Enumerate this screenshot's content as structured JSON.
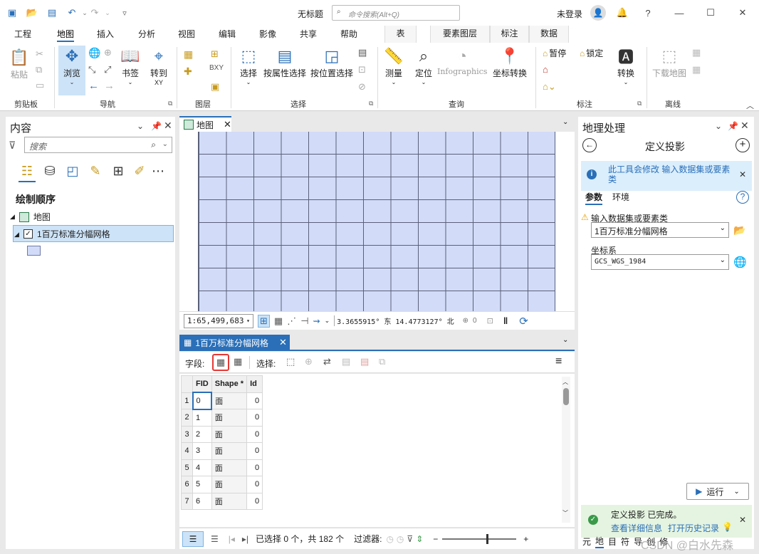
{
  "titlebar": {
    "title": "无标题",
    "search_placeholder": "命令搜索(Alt+Q)",
    "login": "未登录"
  },
  "tabs": [
    "工程",
    "地图",
    "插入",
    "分析",
    "视图",
    "编辑",
    "影像",
    "共享",
    "帮助"
  ],
  "context_tabs": [
    "表",
    "要素图层",
    "标注",
    "数据"
  ],
  "ribbon": {
    "clipboard": {
      "paste": "粘贴",
      "group": "剪贴板"
    },
    "navigate": {
      "explore": "浏览",
      "bookmarks": "书签",
      "goto": "转到",
      "goto_sub": "XY",
      "group": "导航"
    },
    "layer": {
      "group": "图层"
    },
    "selection": {
      "select": "选择",
      "by_attr": "按属性选择",
      "by_loc": "按位置选择",
      "group": "选择"
    },
    "inquiry": {
      "measure": "测量",
      "locate": "定位",
      "infographics": "Infographics",
      "coord": "坐标转换",
      "group": "查询"
    },
    "labeling": {
      "pause": "暂停",
      "lock": "锁定",
      "convert": "转换",
      "group": "标注"
    },
    "offline": {
      "download": "下载地图",
      "group": "离线"
    }
  },
  "content_pane": {
    "title": "内容",
    "search_placeholder": "搜索",
    "draw_order": "绘制顺序",
    "map_node": "地图",
    "layer_name": "1百万标准分幅网格"
  },
  "map": {
    "tab": "地图",
    "scale": "1:65,499,683",
    "coords": "3.3655915° 东 14.4773127° 北",
    "selected_count": "0"
  },
  "attr_table": {
    "tab": "1百万标准分幅网格",
    "fields_label": "字段:",
    "selection_label": "选择:",
    "columns": [
      "FID",
      "Shape *",
      "Id"
    ],
    "rows": [
      [
        "1",
        "0",
        "面",
        "0"
      ],
      [
        "2",
        "1",
        "面",
        "0"
      ],
      [
        "3",
        "2",
        "面",
        "0"
      ],
      [
        "4",
        "3",
        "面",
        "0"
      ],
      [
        "5",
        "4",
        "面",
        "0"
      ],
      [
        "6",
        "5",
        "面",
        "0"
      ],
      [
        "7",
        "6",
        "面",
        "0"
      ]
    ],
    "status": "已选择 0 个，共 182 个",
    "filter_label": "过滤器:"
  },
  "geoprocessing": {
    "title": "地理处理",
    "tool_name": "定义投影",
    "info_text": "此工具会修改 输入数据集或要素类",
    "tab_params": "参数",
    "tab_env": "环境",
    "input_label": "输入数据集或要素类",
    "input_value": "1百万标准分幅网格",
    "coord_label": "坐标系",
    "coord_value": "GCS_WGS_1984",
    "run": "运行",
    "done_text": "定义投影 已完成。",
    "view_details": "查看详细信息",
    "open_history": "打开历史记录"
  },
  "bottom_tabs": [
    "元",
    "地",
    "目",
    "符",
    "导",
    "创",
    "修"
  ],
  "watermark": "CSDN @白水先森"
}
